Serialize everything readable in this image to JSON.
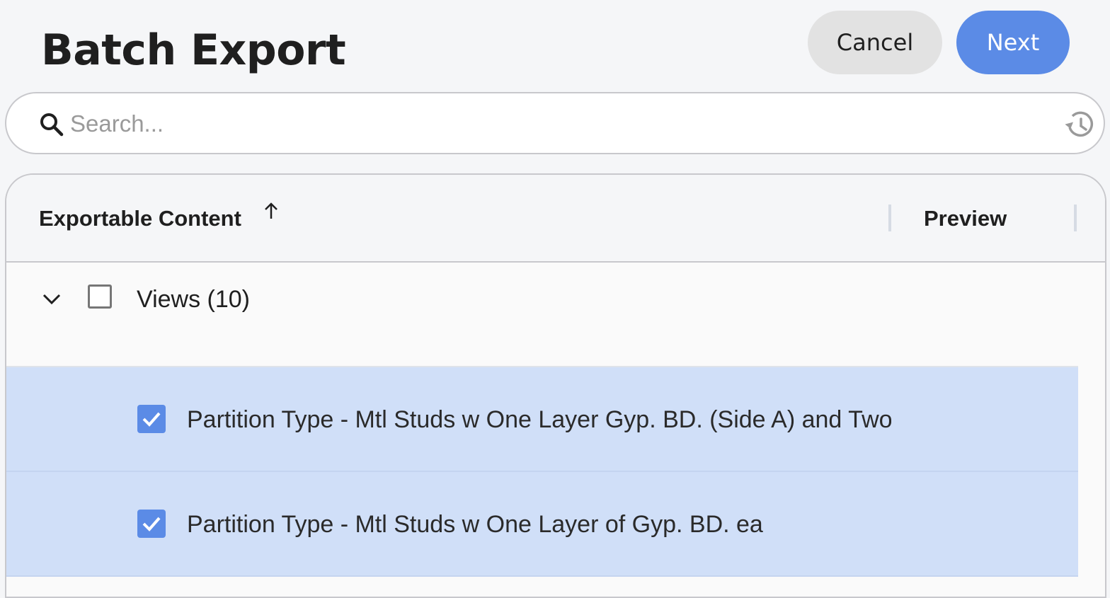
{
  "header": {
    "title": "Batch Export",
    "cancel_label": "Cancel",
    "next_label": "Next"
  },
  "search": {
    "placeholder": "Search...",
    "value": ""
  },
  "table": {
    "columns": {
      "content": "Exportable Content",
      "preview": "Preview"
    },
    "sort": "ascending",
    "group": {
      "label": "Views (10)",
      "expanded": true,
      "checked": false
    },
    "items": [
      {
        "label": "Partition Type - Mtl Studs w One Layer Gyp. BD. (Side A) and Two",
        "checked": true
      },
      {
        "label": "Partition Type - Mtl Studs w One Layer of Gyp. BD. ea",
        "checked": true
      }
    ]
  },
  "colors": {
    "accent": "#5b8be6",
    "selected_row": "#d0dff8",
    "background": "#f5f6f8"
  },
  "icons": [
    "search-icon",
    "history-icon",
    "sort-arrow-up-icon",
    "chevron-down-icon",
    "checkmark-icon"
  ]
}
